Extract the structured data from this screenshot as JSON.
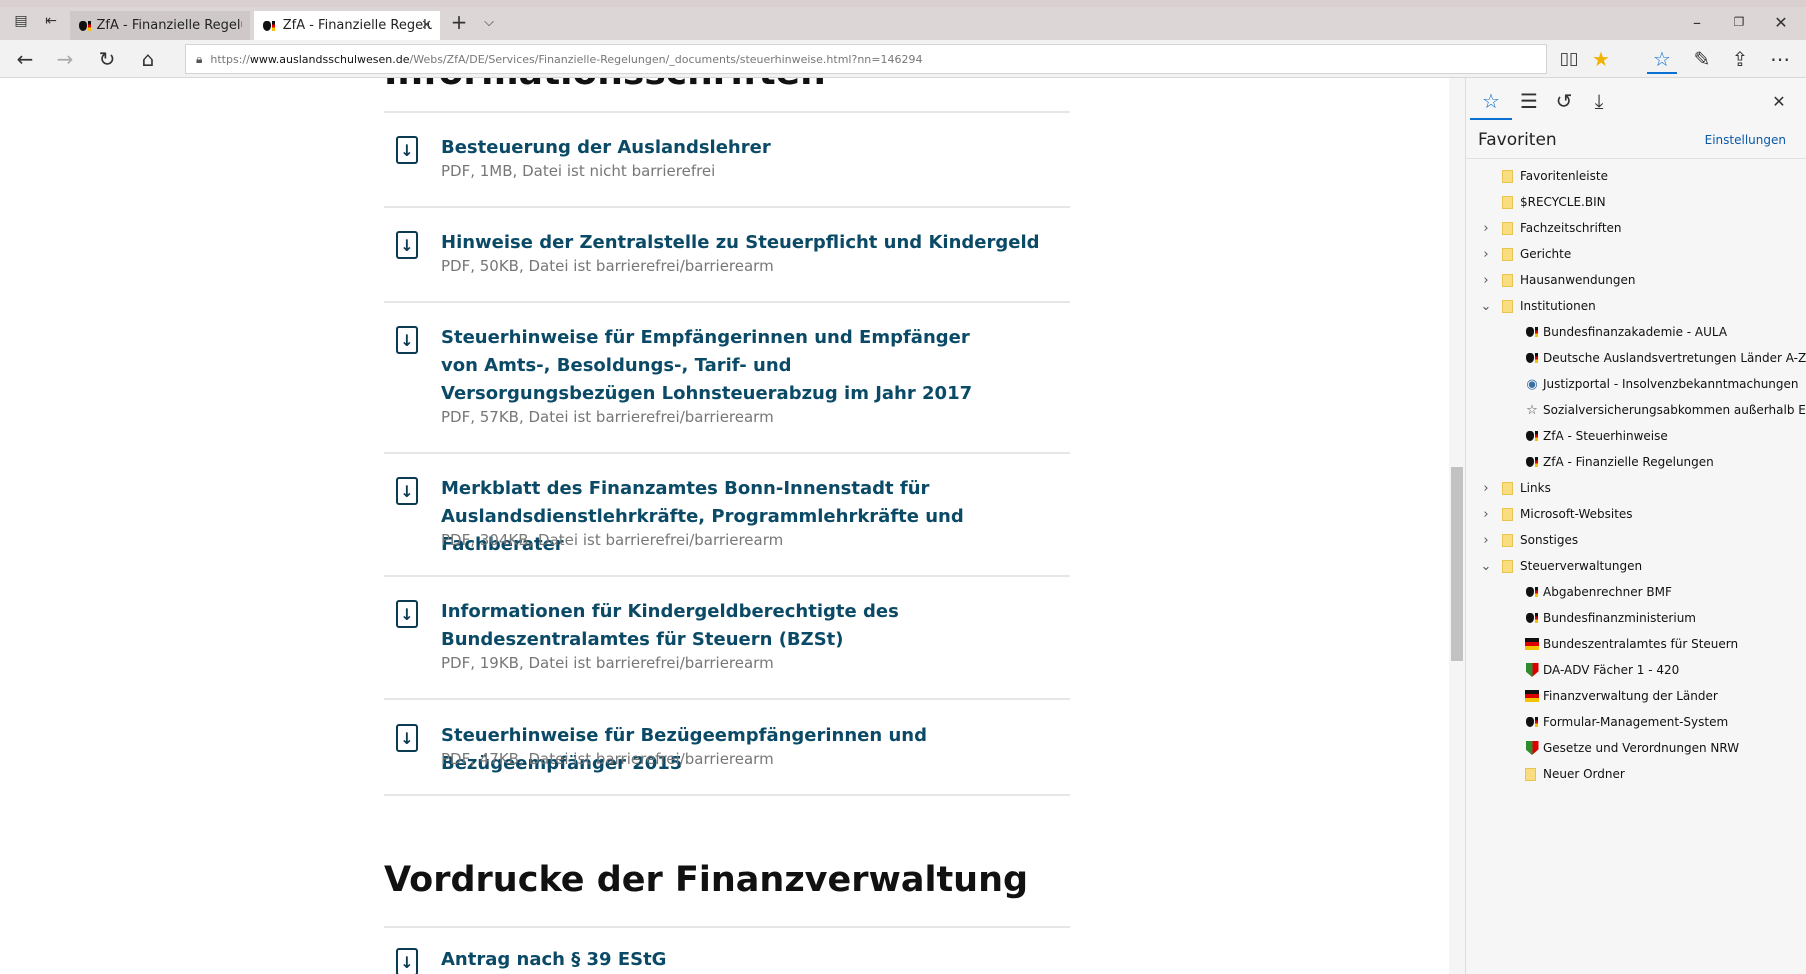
{
  "tabs": [
    {
      "title": "ZfA - Finanzielle Regelunge",
      "active": false
    },
    {
      "title": "ZfA - Finanzielle Regelu",
      "active": true
    }
  ],
  "address": {
    "scheme": "https://",
    "host": "www.auslandsschulwesen.de",
    "path": "/Webs/ZfA/DE/Services/Finanzielle-Regelungen/_documents/steuerhinweise.html?nn=146294"
  },
  "page": {
    "top_heading": "Informationsschriften",
    "documents": [
      {
        "title": "Besteuerung der Auslandslehrer",
        "meta": "PDF, 1MB, Datei ist nicht barrierefrei"
      },
      {
        "title": "Hinweise der Zentralstelle zu Steuerpflicht und Kindergeld",
        "meta": "PDF, 50KB, Datei ist barrierefrei/barrierearm"
      },
      {
        "title": "Steuerhinweise für Empfängerinnen und Empfänger von Amts-, Besoldungs-, Tarif- und Versorgungsbezügen Lohnsteuerabzug im Jahr 2017",
        "meta": "PDF, 57KB, Datei ist barrierefrei/barrierearm"
      },
      {
        "title": "Merkblatt des Finanzamtes Bonn-Innenstadt für Auslandsdienstlehrkräfte, Programmlehrkräfte und Fachberater",
        "meta": "PDF, 304KB, Datei ist barrierefrei/barrierearm"
      },
      {
        "title": "Informationen für Kindergeldberechtigte des Bundeszentralamtes für Steuern (BZSt)",
        "meta": "PDF, 19KB, Datei ist barrierefrei/barrierearm"
      },
      {
        "title": "Steuerhinweise für Bezügeempfängerinnen und Bezügeempfänger 2015",
        "meta": "PDF, 47KB, Datei ist barrierefrei/barrierearm"
      }
    ],
    "second_heading": "Vordrucke der Finanzverwaltung",
    "partial_item": "Antrag nach § 39 EStG"
  },
  "hub": {
    "title": "Favoriten",
    "settings_label": "Einstellungen",
    "items": [
      {
        "label": "Favoritenleiste",
        "type": "folder",
        "level": 0,
        "chevron": ""
      },
      {
        "label": "$RECYCLE.BIN",
        "type": "folder",
        "level": 0,
        "chevron": ""
      },
      {
        "label": "Fachzeitschriften",
        "type": "folder",
        "level": 0,
        "chevron": "›"
      },
      {
        "label": "Gerichte",
        "type": "folder",
        "level": 0,
        "chevron": "›"
      },
      {
        "label": "Hausanwendungen",
        "type": "folder",
        "level": 0,
        "chevron": "›"
      },
      {
        "label": "Institutionen",
        "type": "folder",
        "level": 0,
        "chevron": "⌄"
      },
      {
        "label": "Bundesfinanzakademie - AULA",
        "type": "eagle",
        "level": 1
      },
      {
        "label": "Deutsche Auslandsvertretungen Länder A-Z",
        "type": "eagle",
        "level": 1
      },
      {
        "label": "Justizportal - Insolvenzbekanntmachungen",
        "type": "globe",
        "level": 1
      },
      {
        "label": "Sozialversicherungsabkommen außerhalb EU_E",
        "type": "star",
        "level": 1
      },
      {
        "label": "ZfA - Steuerhinweise",
        "type": "eagle",
        "level": 1
      },
      {
        "label": "ZfA - Finanzielle Regelungen",
        "type": "eagle",
        "level": 1
      },
      {
        "label": "Links",
        "type": "folder",
        "level": 0,
        "chevron": "›"
      },
      {
        "label": "Microsoft-Websites",
        "type": "folder",
        "level": 0,
        "chevron": "›"
      },
      {
        "label": "Sonstiges",
        "type": "folder",
        "level": 0,
        "chevron": "›"
      },
      {
        "label": "Steuerverwaltungen",
        "type": "folder",
        "level": 0,
        "chevron": "⌄"
      },
      {
        "label": "Abgabenrechner BMF",
        "type": "eagle",
        "level": 1
      },
      {
        "label": "Bundesfinanzministerium",
        "type": "eagle",
        "level": 1
      },
      {
        "label": "Bundeszentralamtes für Steuern",
        "type": "flag",
        "level": 1
      },
      {
        "label": "DA-ADV Fächer 1 - 420",
        "type": "nrw",
        "level": 1
      },
      {
        "label": "Finanzverwaltung der Länder",
        "type": "flag",
        "level": 1
      },
      {
        "label": "Formular-Management-System",
        "type": "eagle",
        "level": 1
      },
      {
        "label": "Gesetze und Verordnungen NRW",
        "type": "nrw",
        "level": 1
      },
      {
        "label": "Neuer Ordner",
        "type": "folder",
        "level": 1
      }
    ]
  }
}
